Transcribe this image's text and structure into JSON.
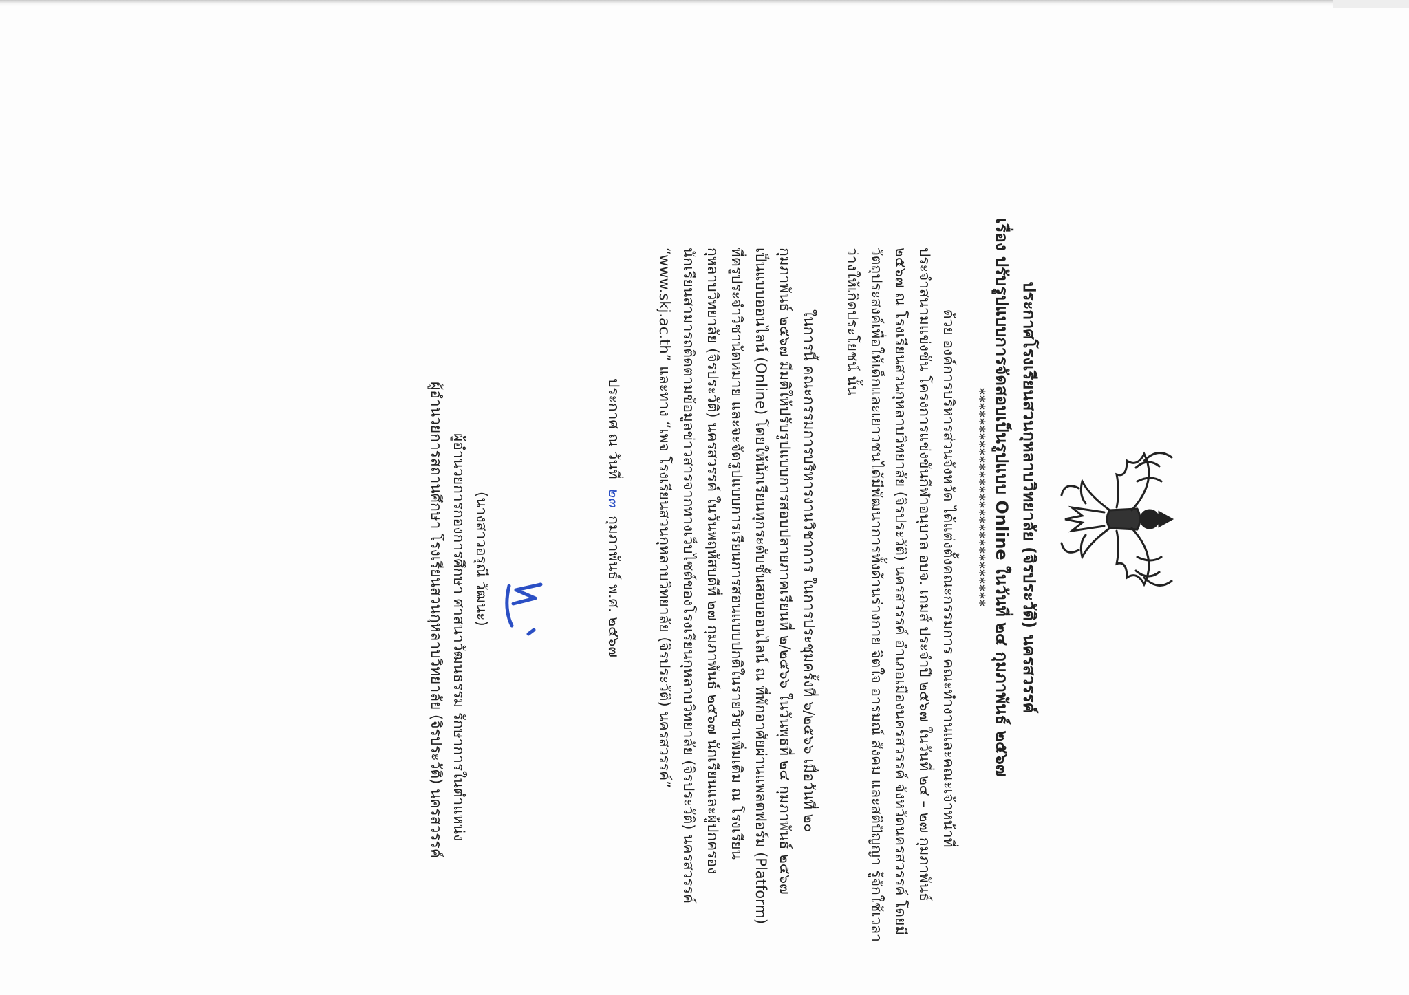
{
  "header": {
    "title": "ประกาศโรงเรียนสวนกุหลาบวิทยาลัย (จิรประวัติ) นครสวรรค์",
    "subject": "เรื่อง ปรับรูปแบบการจัดสอบเป็นรูปแบบ Online ในวันที่ ๒๔ กุมภาพันธ์ ๒๕๖๗",
    "separator": "*****************************"
  },
  "paragraph1": {
    "lines": [
      "ด้วย องค์การบริหารส่วนจังหวัด ได้แต่งตั้งคณะกรรมการ คณะทำงานและคณะเจ้าหน้าที่",
      "ประจำสนามแข่งขัน โครงการแข่งขันกีฬาอนุบาล อบจ. เกมส์ ประจำปี ๒๕๖๗ ในวันที่ ๒๔ – ๒๗ กุมภาพันธ์",
      "๒๕๖๗ ณ โรงเรียนสวนกุหลาบวิทยาลัย (จิรประวัติ) นครสวรรค์ อำเภอเมืองนครสวรรค์ จังหวัดนครสวรรค์ โดยมี",
      "วัตถุประสงค์เพื่อให้เด็กและเยาวชนได้มีพัฒนาการทั้งด้านร่างกาย จิตใจ อารมณ์ สังคม และสติปัญญา รู้จักใช้เวลา",
      "ว่างให้เกิดประโยชน์ นั้น"
    ]
  },
  "paragraph2": {
    "lines": [
      "ในการนี้ คณะกรรมการบริหารงานวิชาการ ในการประชุมครั้งที่ ๖/๒๕๖๖ เมื่อวันที่ ๒๐",
      "กุมภาพันธ์ ๒๕๖๗ มีมติให้ปรับรูปแบบการสอบปลายภาคเรียนที่ ๒/๒๕๖๖ ในวันพุธที่ ๒๔ กุมภาพันธ์ ๒๕๖๗",
      "เป็นแบบออนไลน์ (Online) โดยให้นักเรียนทุกระดับชั้นสอบออนไลน์ ณ ที่พักอาศัยผ่านแพลตฟอร์ม (Platform)",
      "ที่ครูประจำวิชานัดหมาย และจะจัดรูปแบบการเรียนการสอนแบบปกติในรายวิชาเพิ่มเติม ณ โรงเรียน",
      "กุหลาบวิทยาลัย (จิรประวัติ) นครสวรรค์ ในวันพฤหัสบดีที่ ๒๗ กุมภาพันธ์ ๒๕๖๗ นักเรียนและผู้ปกครอง",
      "นักเรียนสามารถติดตามข้อมูลข่าวสารจากทางเว็บไซต์ของโรงเรียนกุหลาบวิทยาลัย (จิรประวัติ) นครสวรรค์",
      "“www.skj.ac.th” และทาง “เพจ โรงเรียนสวนกุหลาบวิทยาลัย (จิรประวัติ) นครสวรรค์”"
    ]
  },
  "announcement": {
    "text": "ประกาศ ณ วันที่",
    "day": "๒๓",
    "month_year": "กุมภาพันธ์  พ.ศ. ๒๕๖๗"
  },
  "signature": {
    "name": "(นางสาวอรุณี วัฒนะ)",
    "position1": "ผู้อำนวยการกองการศึกษา ศาสนาวัฒนธรรม รักษาการในตำแหน่ง",
    "position2": "ผู้อำนวยการสถานศึกษา โรงเรียนสวนกุหลาบวิทยาลัย (จิรประวัติ) นครสวรรค์"
  },
  "colors": {
    "text": "#222222",
    "ink_blue": "#2b4fc4"
  }
}
